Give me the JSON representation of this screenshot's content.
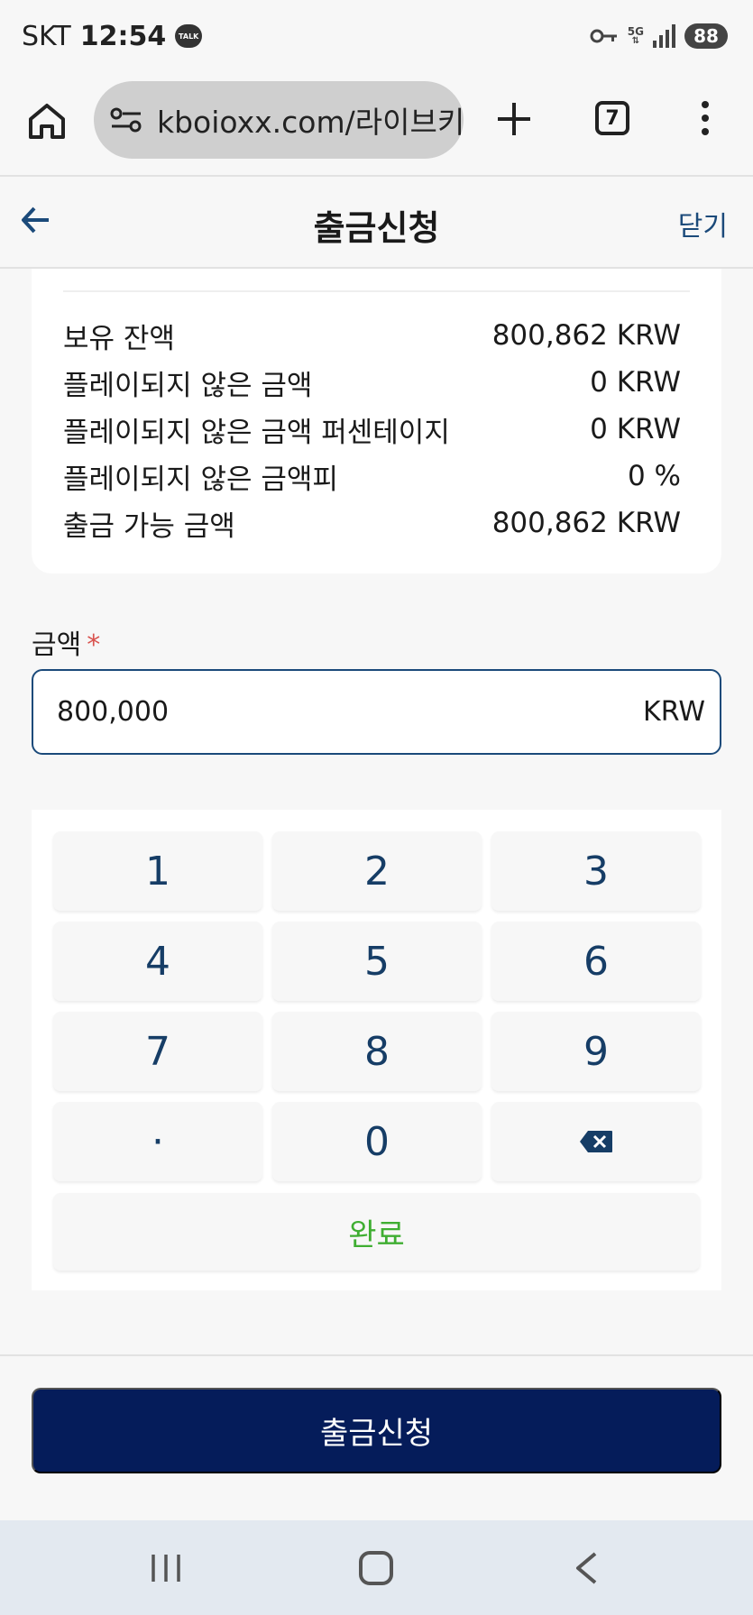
{
  "status_bar": {
    "carrier": "SKT",
    "time": "12:54",
    "talk_badge": "TALK",
    "network": "5G",
    "battery": "88"
  },
  "browser": {
    "url": "kboioxx.com/라이브키",
    "tab_count": "7"
  },
  "header": {
    "title": "출금신청",
    "close_label": "닫기"
  },
  "balance": {
    "rows": [
      {
        "label": "보유 잔액",
        "value": "800,862 KRW"
      },
      {
        "label": "플레이되지 않은 금액",
        "value": "0 KRW"
      },
      {
        "label": "플레이되지 않은 금액 퍼센테이지",
        "value": "0 KRW"
      },
      {
        "label": "플레이되지 않은 금액피",
        "value": "0 %"
      },
      {
        "label": "출금 가능 금액",
        "value": "800,862 KRW"
      }
    ]
  },
  "amount": {
    "label": "금액",
    "required_mark": "*",
    "value": "800,000",
    "unit": "KRW"
  },
  "keypad": {
    "keys": [
      "1",
      "2",
      "3",
      "4",
      "5",
      "6",
      "7",
      "8",
      "9",
      "·",
      "0"
    ],
    "done_label": "완료"
  },
  "submit": {
    "label": "출금신청"
  },
  "colors": {
    "accent": "#1b4a7a",
    "key_text": "#163d66",
    "done_green": "#3fae32",
    "submit_bg": "#051c5a",
    "required_red": "#d9534f"
  }
}
